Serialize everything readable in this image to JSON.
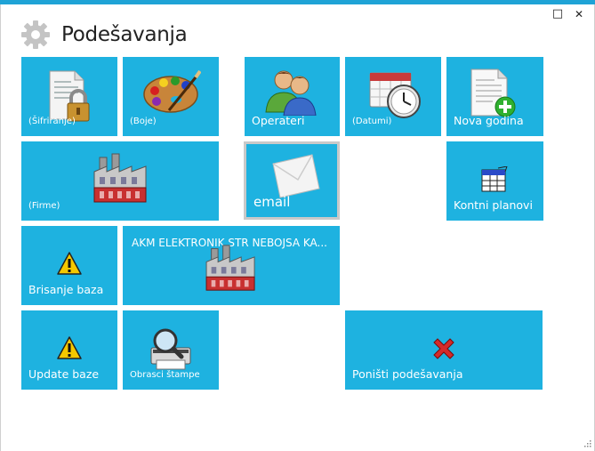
{
  "window": {
    "title": "Podešavanja",
    "maximize_glyph": "□",
    "close_glyph": "✕"
  },
  "tiles": {
    "sifriranje": {
      "label": "(Šifriranje)",
      "icon": "lock-document-icon"
    },
    "boje": {
      "label": "(Boje)",
      "icon": "palette-icon"
    },
    "operateri": {
      "label": "Operateri",
      "icon": "users-icon"
    },
    "datumi": {
      "label": "(Datumi)",
      "icon": "calendar-clock-icon"
    },
    "nova_godina": {
      "label": "Nova godina",
      "icon": "new-document-icon"
    },
    "firme": {
      "label": "(Firme)",
      "icon": "factory-icon"
    },
    "email": {
      "label": "email",
      "icon": "envelope-icon"
    },
    "kontni_planovi": {
      "label": "Kontni planovi",
      "icon": "table-document-icon"
    },
    "brisanje_baza": {
      "label": "Brisanje baza",
      "icon": "warning-icon"
    },
    "firma_akm": {
      "label": "AKM ELEKTRONIK STR NEBOJSA KA...",
      "icon": "factory-icon"
    },
    "update_baze": {
      "label": "Update baze",
      "icon": "warning-icon"
    },
    "obrasci_stampe": {
      "label": "Obrasci štampe",
      "icon": "printer-magnifier-icon"
    },
    "ponisti": {
      "label": "Poništi podešavanja",
      "icon": "red-x-icon"
    }
  },
  "colors": {
    "tile": "#1eb2e0",
    "accent_bar": "#1fa3d6",
    "email_border": "#c9c9c9"
  }
}
